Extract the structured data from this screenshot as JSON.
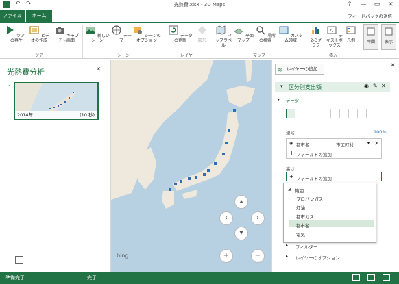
{
  "window": {
    "title": "光熱費.xlsx - 3D Maps",
    "help": "?",
    "minimize": "—",
    "restore": "▭",
    "close": "✕"
  },
  "tabs": {
    "file": "ファイル",
    "home": "ホーム",
    "feedback": "フィードバックの送信"
  },
  "ribbon": {
    "play_tour": "ツアーの再生",
    "create_video": "ビデオの作成",
    "capture_screen": "キャプチャ画面",
    "group_tour": "ツアー",
    "new_scene": "新しいシーン",
    "theme": "テーマ",
    "scene_options": "シーンのオプション",
    "group_scene": "シーン",
    "refresh_data": "データの更新",
    "shapes": "図形",
    "group_layer": "レイヤー",
    "map_labels": "マップラベル",
    "flat_map": "平面マップ",
    "find_location": "場所の検索",
    "custom_regions": "カスタム領域",
    "group_map": "マップ",
    "chart_2d": "2-Dグラフ",
    "text_box": "テキストボックス",
    "legend": "凡例",
    "group_insert": "挿入",
    "time": "時間",
    "display": "表示"
  },
  "tour_panel": {
    "title": "光熱費分析",
    "scene_number": "1",
    "scene_year": "2014年",
    "scene_duration": "(10 秒)"
  },
  "map": {
    "bing": "bing"
  },
  "layer_pane": {
    "add_layer": "レイヤーの追加",
    "layer_name": "区分別支出額",
    "data_section": "データ",
    "location_label": "場所",
    "location_percent": "100%",
    "location_field": "都市名",
    "location_type": "市区町村",
    "add_field": "フィールドの追加",
    "height_label": "高さ",
    "height_add_field": "フィールドの追加",
    "filter": "フィルター",
    "layer_options": "レイヤーのオプション",
    "dropdown": {
      "group": "範囲",
      "items": [
        "プロパンガス",
        "灯油",
        "都市ガス",
        "都市名",
        "電気"
      ],
      "selected": "都市ガス"
    }
  },
  "status": {
    "ready": "準備完了",
    "done": "完了"
  },
  "colors": {
    "accent": "#217346",
    "map_water": "#b7d1e2",
    "data_bar": "#2e6db4"
  }
}
